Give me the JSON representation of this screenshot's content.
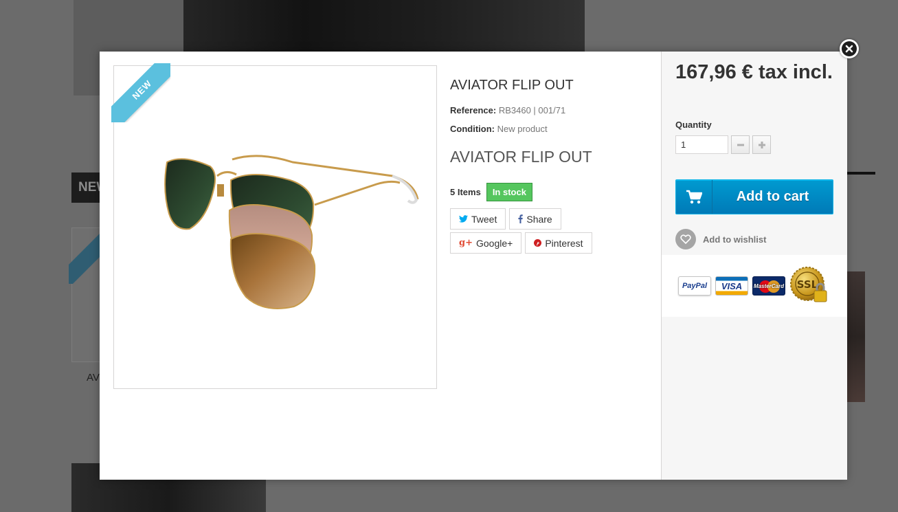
{
  "background": {
    "section_heading": "NEW",
    "card_ribbon": "NEW",
    "card_title": "AV"
  },
  "product": {
    "ribbon": "NEW",
    "title": "AVIATOR FLIP OUT",
    "reference_label": "Reference:",
    "reference_value": "RB3460 | 001/71",
    "condition_label": "Condition:",
    "condition_value": "New product",
    "subtitle": "AVIATOR FLIP OUT",
    "items": "5 Items",
    "stock": "In stock",
    "image_icon": "aviator-sunglasses-image"
  },
  "social": [
    {
      "label": "Tweet",
      "icon": "twitter-icon",
      "color": "#00aaf0"
    },
    {
      "label": "Share",
      "icon": "facebook-icon",
      "color": "#435f9f"
    },
    {
      "label": "Google+",
      "icon": "google-plus-icon",
      "color": "#e04b34"
    },
    {
      "label": "Pinterest",
      "icon": "pinterest-icon",
      "color": "#ce1f21"
    }
  ],
  "buy": {
    "price": "167,96 € tax incl.",
    "quantity_label": "Quantity",
    "quantity_value": "1",
    "add_to_cart": "Add to cart",
    "wishlist": "Add to wishlist"
  },
  "payment": {
    "paypal": "PayPal",
    "visa": "VISA",
    "mastercard": "MasterCard",
    "ssl": "SSL"
  },
  "colors": {
    "accent_blue": "#0089c7",
    "ribbon": "#5bc0de",
    "stock_green": "#55c65e",
    "overlay": "#6b6b6b"
  }
}
